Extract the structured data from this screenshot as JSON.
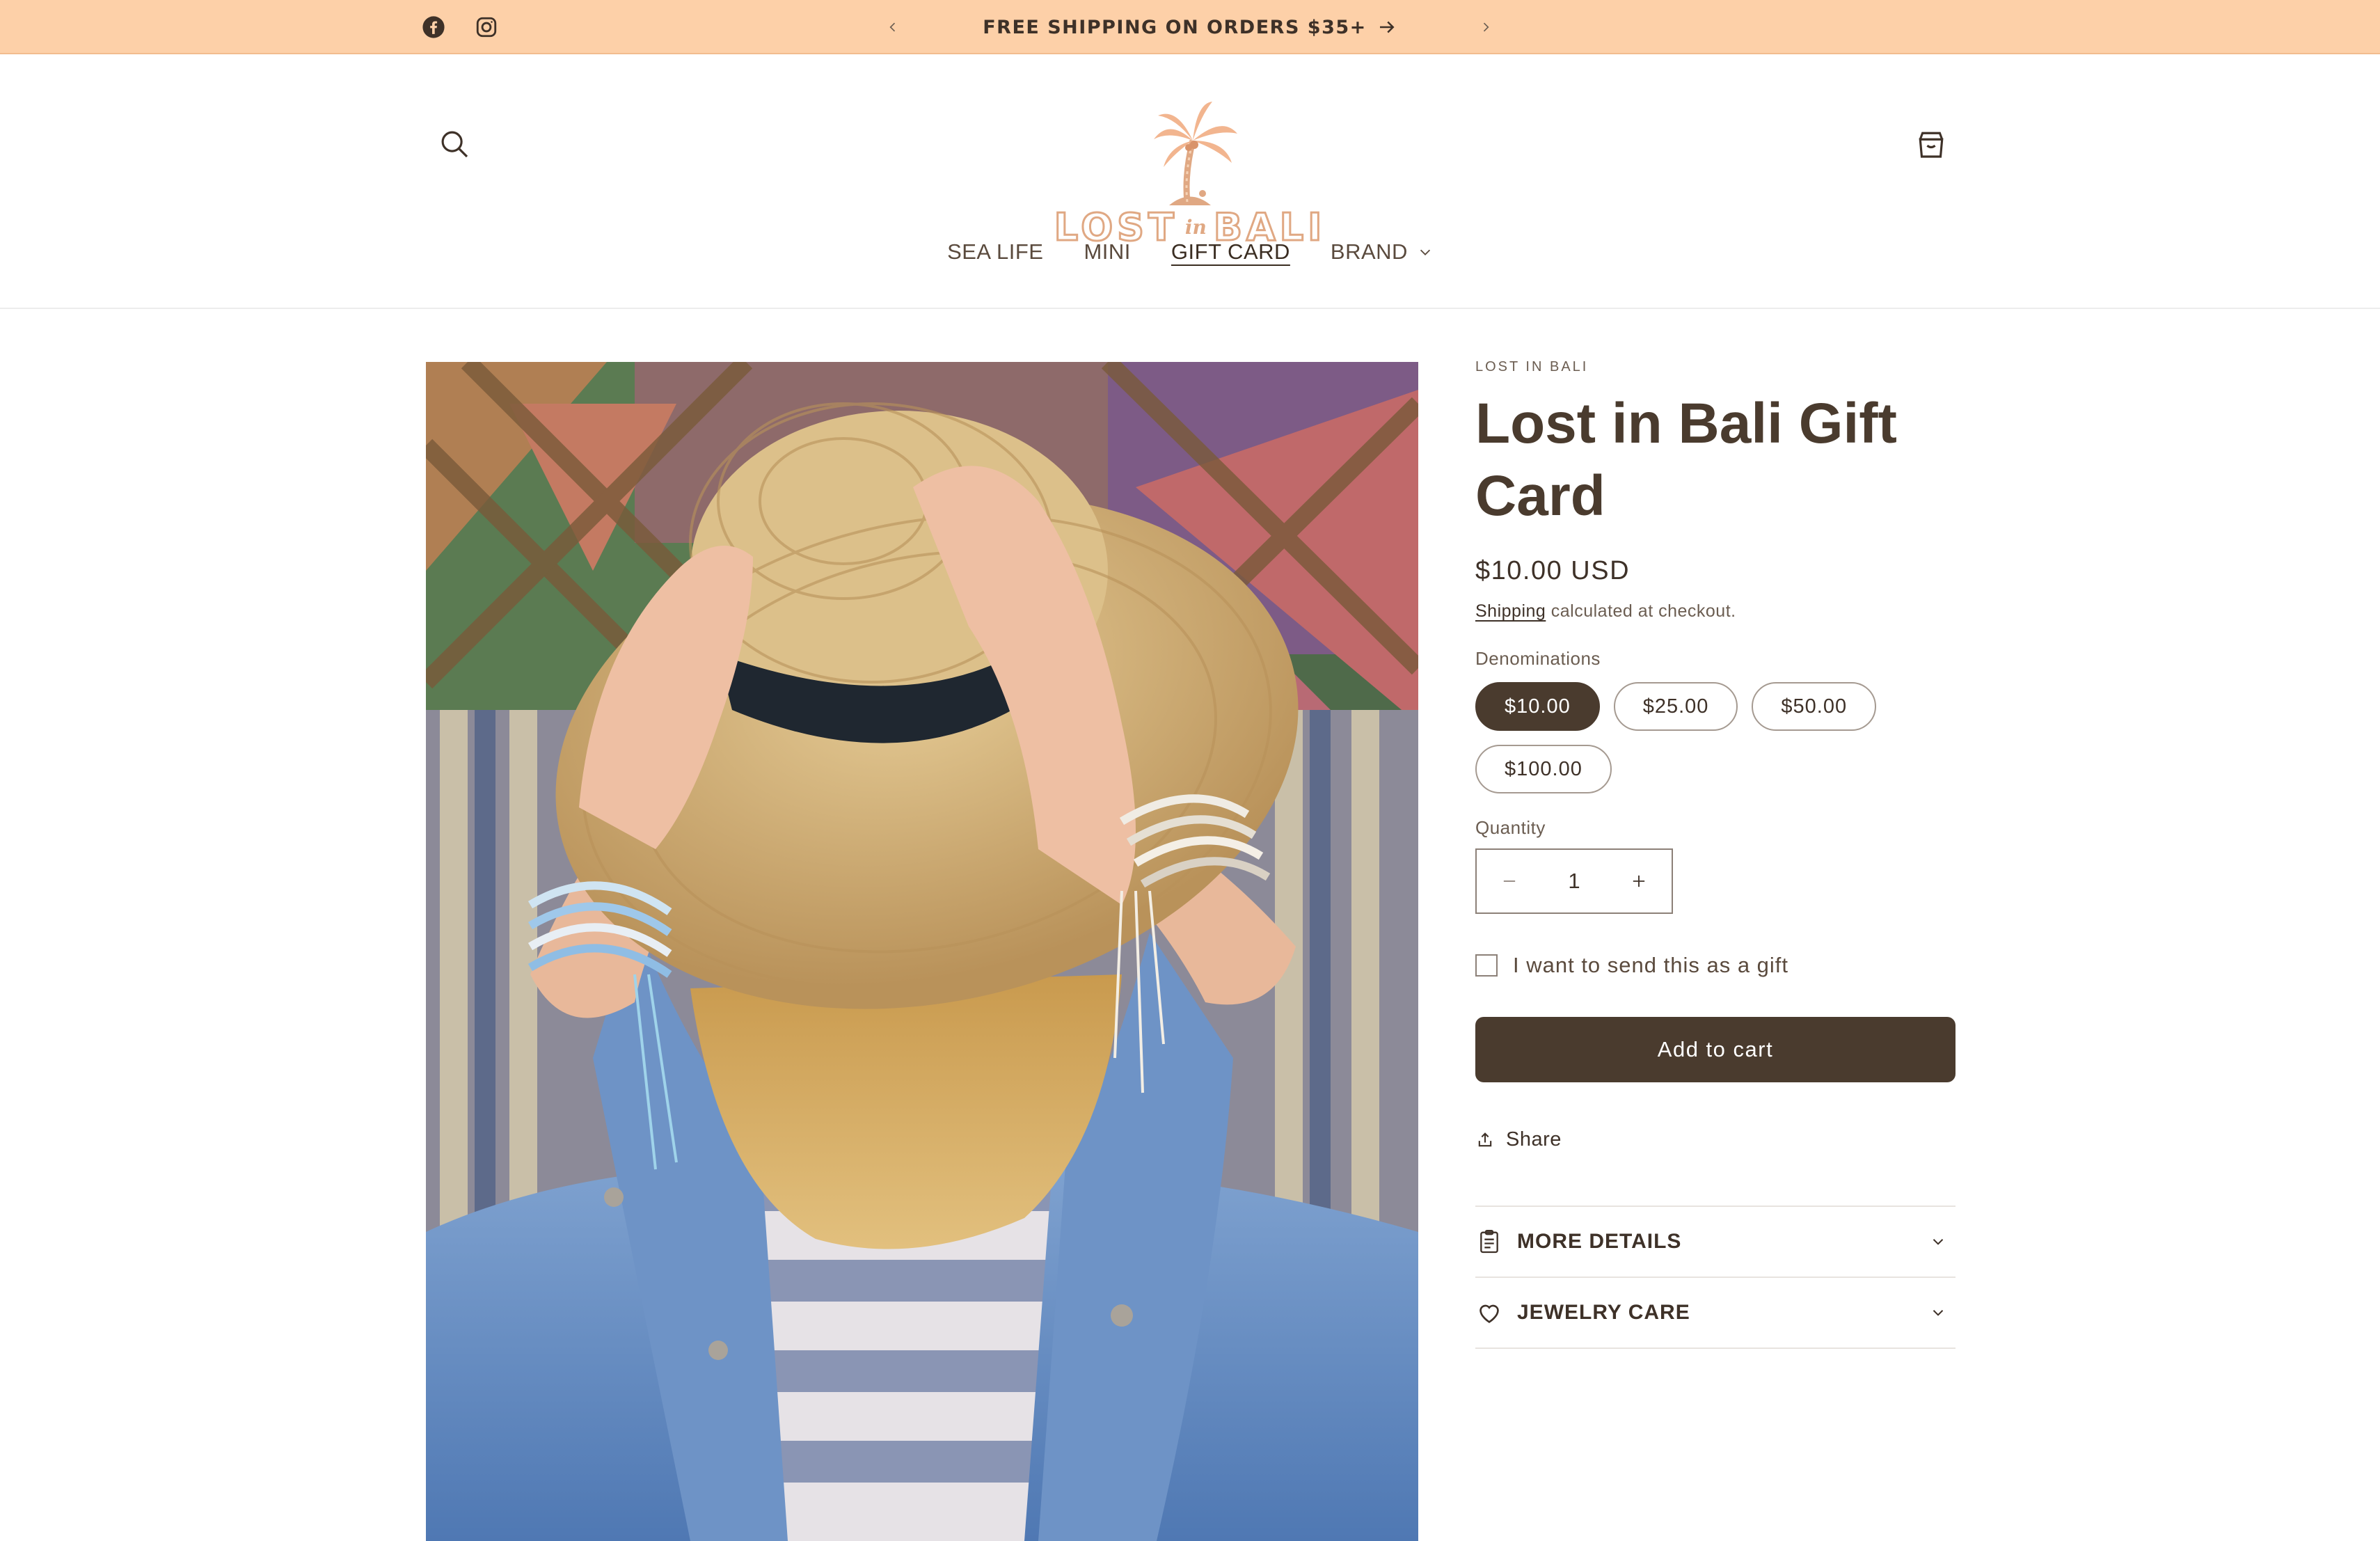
{
  "announcement": {
    "message": "FREE SHIPPING ON ORDERS $35+"
  },
  "header": {
    "logo": {
      "word_left": "LOST",
      "word_middle": "in",
      "word_right": "BALI"
    },
    "nav": [
      {
        "label": "SEA LIFE"
      },
      {
        "label": "MINI"
      },
      {
        "label": "GIFT CARD",
        "active": true
      },
      {
        "label": "BRAND",
        "has_dropdown": true
      }
    ]
  },
  "product": {
    "vendor": "LOST IN BALI",
    "title": "Lost in Bali Gift Card",
    "price": "$10.00 USD",
    "shipping_link": "Shipping",
    "shipping_rest": "calculated at checkout.",
    "denominations_label": "Denominations",
    "denominations": [
      {
        "label": "$10.00",
        "selected": true
      },
      {
        "label": "$25.00"
      },
      {
        "label": "$50.00"
      },
      {
        "label": "$100.00"
      }
    ],
    "quantity_label": "Quantity",
    "quantity_value": "1",
    "gift_checkbox_label": "I want to send this as a gift",
    "gift_checked": false,
    "add_to_cart": "Add to cart",
    "share": "Share",
    "accordion": [
      {
        "title": "MORE DETAILS",
        "icon": "clipboard-icon"
      },
      {
        "title": "JEWELRY CARE",
        "icon": "heart-icon"
      }
    ]
  },
  "colors": {
    "announcement_bg": "#fdd0a8",
    "brand_brown": "#4a3b2e",
    "logo_peach": "#e0a883"
  }
}
